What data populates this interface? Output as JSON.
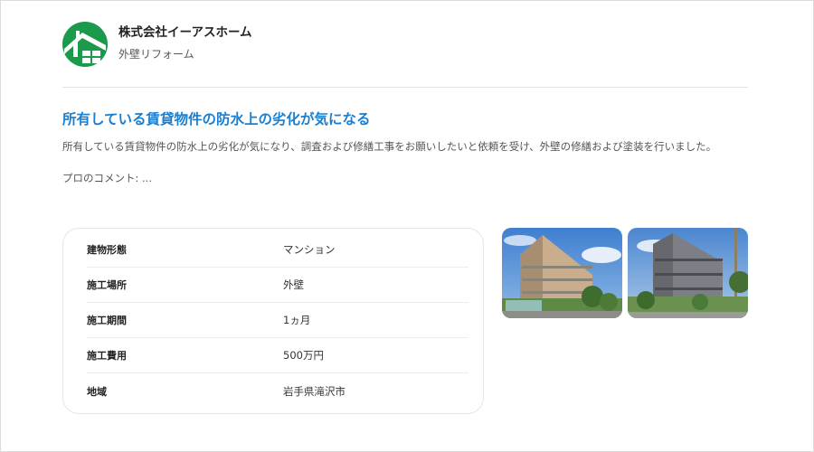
{
  "company": {
    "name": "株式会社イーアスホーム",
    "category": "外壁リフォーム",
    "brand_color": "#1a9a4a"
  },
  "case": {
    "title": "所有している賃貸物件の防水上の劣化が気になる",
    "description": "所有している賃貸物件の防水上の劣化が気になり、調査および修繕工事をお願いしたいと依頼を受け、外壁の修繕および塗装を行いました。",
    "comment": "プロのコメント: ..."
  },
  "specs": [
    {
      "label": "建物形態",
      "value": "マンション"
    },
    {
      "label": "施工場所",
      "value": "外壁"
    },
    {
      "label": "施工期間",
      "value": "1ヵ月"
    },
    {
      "label": "施工費用",
      "value": "500万円"
    },
    {
      "label": "地域",
      "value": "岩手県滝沢市"
    }
  ],
  "photos": [
    {
      "name": "before-photo"
    },
    {
      "name": "after-photo"
    }
  ],
  "colors": {
    "title": "#1a7ed1",
    "logo_green": "#1a9a4a"
  }
}
